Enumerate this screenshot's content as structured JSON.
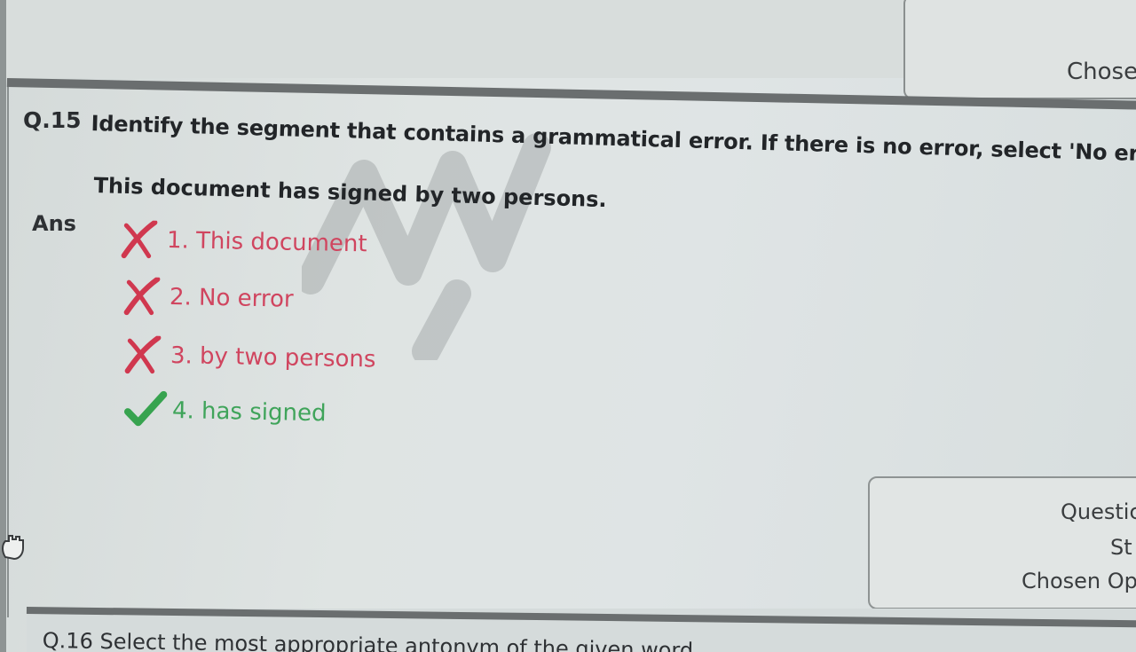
{
  "top_status": {
    "chosen_label": "Chose"
  },
  "question": {
    "number": "Q.15",
    "prompt": "Identify the segment that contains a grammatical error. If there is no error, select 'No error'",
    "sentence": "This document has signed by two persons."
  },
  "answer": {
    "label": "Ans",
    "options": [
      {
        "text": "1. This document",
        "status": "wrong",
        "icon": "cross-icon"
      },
      {
        "text": "2. No error",
        "status": "wrong",
        "icon": "cross-icon"
      },
      {
        "text": "3. by two persons",
        "status": "wrong",
        "icon": "cross-icon"
      },
      {
        "text": "4. has signed",
        "status": "correct",
        "icon": "check-icon"
      }
    ]
  },
  "status_box": {
    "question_id_label": "Questic",
    "status_label": "St",
    "chosen_option_label": "Chosen Op"
  },
  "next_question": {
    "text": "Q.16  Select the most appropriate antonym of the given word"
  },
  "colors": {
    "wrong": "#d0455f",
    "correct": "#3fa45a",
    "rule": "#6a6e6f"
  }
}
